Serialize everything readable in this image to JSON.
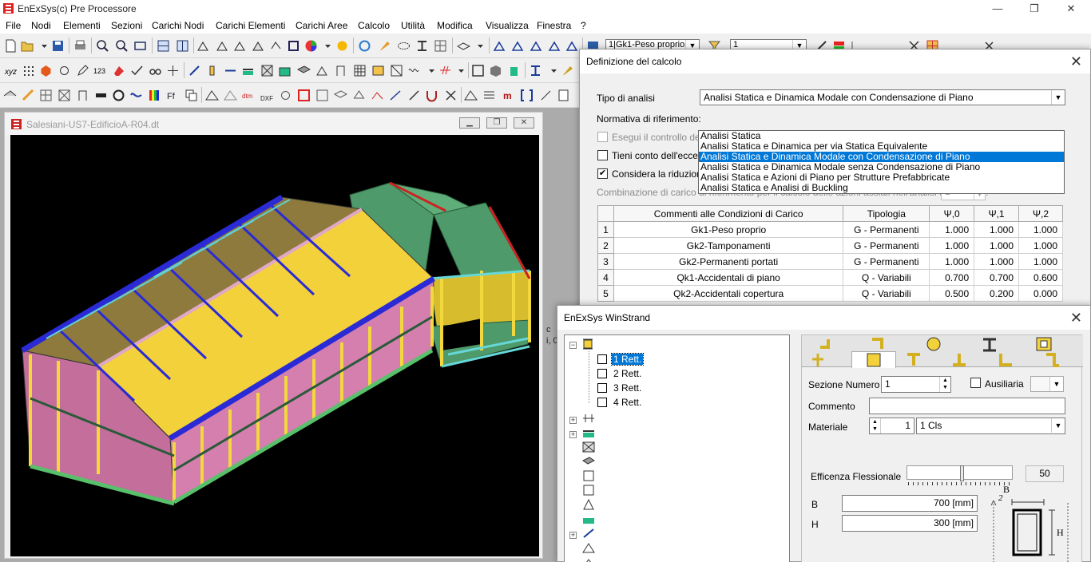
{
  "app": {
    "title": "EnExSys(c) Pre Processore"
  },
  "window_controls": {
    "minimize": "—",
    "restore": "❐",
    "close": "✕"
  },
  "menu": [
    "File",
    "Nodi",
    "Elementi",
    "Sezioni",
    "Carichi Nodi",
    "Carichi Elementi",
    "Carichi Aree",
    "Calcolo",
    "Utilità",
    "Modifica",
    "Visualizza",
    "Finestra",
    "?"
  ],
  "toolbar": {
    "load_case_combo": "1|Gk1-Peso proprio",
    "second_combo": "1"
  },
  "child_window": {
    "title": "Salesiani-US7-EdificioA-R04.dt",
    "stray_text": "c",
    "stray_text2": "i, 0"
  },
  "calc_dialog": {
    "title": "Definizione del calcolo",
    "tipo_label": "Tipo di analisi",
    "tipo_value": "Analisi Statica e Dinamica Modale con Condensazione di Piano",
    "options": [
      "Analisi Statica",
      "Analisi Statica e Dinamica per via Statica Equivalente",
      "Analisi Statica e Dinamica Modale con Condensazione di Piano",
      "Analisi Statica e Dinamica Modale senza Condensazione di Piano",
      "Analisi Statica e Azioni di Piano per Strutture Prefabbricate",
      "Analisi Statica e Analisi di Buckling"
    ],
    "selected_option_index": 2,
    "normativa_label": "Normativa di riferimento:",
    "check1_label": "Esegui il controllo degli",
    "check2_label": "Tieni conto dell'eccentri",
    "check3_label": "Considera la riduzione della capacità taglianti/flessionali delle sezioni definite",
    "check3_checked": true,
    "buckling_label": "Combinazione di carico di riferimento per il calcolo delle azioni assiali nell'analisi di Buckling:",
    "buckling_value": "1",
    "table": {
      "headers": [
        "Commenti  alle  Condizioni  di  Carico",
        "Tipologia",
        "Ψ,0",
        "Ψ,1",
        "Ψ,2"
      ],
      "rows": [
        [
          "1",
          "Gk1-Peso proprio",
          "G - Permanenti",
          "1.000",
          "1.000",
          "1.000"
        ],
        [
          "2",
          "Gk2-Tamponamenti",
          "G - Permanenti",
          "1.000",
          "1.000",
          "1.000"
        ],
        [
          "3",
          "Gk2-Permanenti portati",
          "G - Permanenti",
          "1.000",
          "1.000",
          "1.000"
        ],
        [
          "4",
          "Qk1-Accidentali di piano",
          "Q - Variabili",
          "0.700",
          "0.700",
          "0.600"
        ],
        [
          "5",
          "Qk2-Accidentali copertura",
          "Q - Variabili",
          "0.500",
          "0.200",
          "0.000"
        ]
      ]
    }
  },
  "winstrand": {
    "title": "EnExSys WinStrand",
    "tree_items": [
      "1 Rett.",
      "2 Rett.",
      "3 Rett.",
      "4 Rett."
    ],
    "sezione_label": "Sezione Numero",
    "sezione_value": "1",
    "ausiliaria_label": "Ausiliaria",
    "commento_label": "Commento",
    "commento_value": "",
    "materiale_label": "Materiale",
    "materiale_num": "1",
    "materiale_value": "1 Cls",
    "efficienza_label": "Efficenza Flessionale",
    "efficienza_value": "50",
    "b_label": "B",
    "b_value": "700 [mm]",
    "h_label": "H",
    "h_value": "300 [mm]",
    "diagram_b": "B",
    "diagram_h": "H",
    "diagram_axis": "2"
  },
  "colors": {
    "selection": "#0078d7",
    "roof": "#f2d13a",
    "walls": "#d47fae",
    "beams": "#2b2bd6",
    "annex": "#4e9a6a"
  }
}
